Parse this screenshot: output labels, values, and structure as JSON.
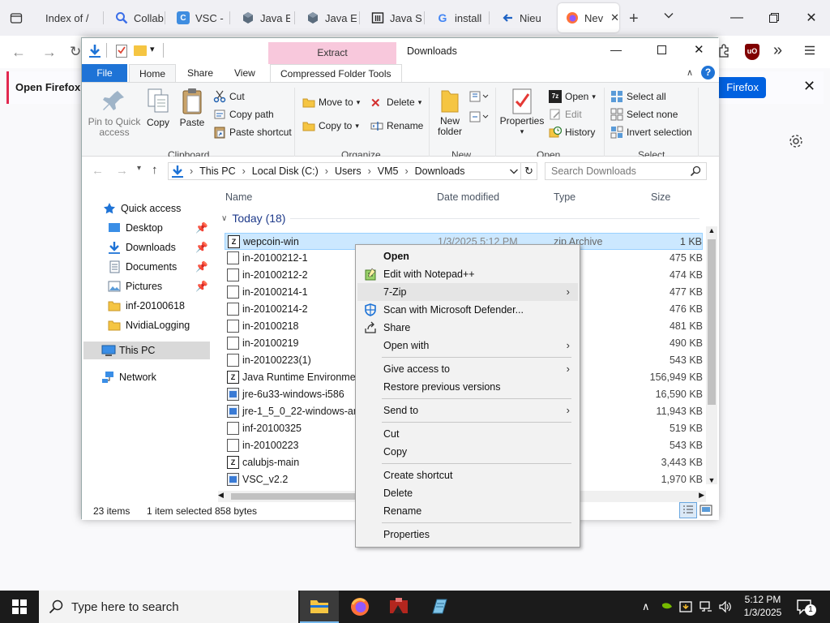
{
  "browser": {
    "tabs": [
      {
        "label": "Index of /"
      },
      {
        "label": "Collab"
      },
      {
        "label": "VSC -"
      },
      {
        "label": "Java E"
      },
      {
        "label": "Java E"
      },
      {
        "label": "Java S"
      },
      {
        "label": "install"
      },
      {
        "label": "Nieu"
      },
      {
        "label": "Nev"
      }
    ],
    "notification": {
      "text": "Open Firefox e",
      "button": "Firefox"
    }
  },
  "explorer": {
    "title": "Downloads",
    "context_tab": "Extract",
    "ribbon_tabs": [
      "File",
      "Home",
      "Share",
      "View",
      "Compressed Folder Tools"
    ],
    "clipboard": {
      "pin": "Pin to Quick access",
      "copy": "Copy",
      "paste": "Paste",
      "cut": "Cut",
      "copy_path": "Copy path",
      "paste_shortcut": "Paste shortcut",
      "group": "Clipboard"
    },
    "organize": {
      "move_to": "Move to",
      "copy_to": "Copy to",
      "delete": "Delete",
      "rename": "Rename",
      "group": "Organize"
    },
    "new": {
      "new_folder": "New folder",
      "group": "New"
    },
    "open": {
      "properties": "Properties",
      "open": "Open",
      "edit": "Edit",
      "history": "History",
      "group": "Open"
    },
    "select": {
      "select_all": "Select all",
      "select_none": "Select none",
      "invert": "Invert selection",
      "group": "Select"
    },
    "address": {
      "crumbs": [
        "This PC",
        "Local Disk (C:)",
        "Users",
        "VM5",
        "Downloads"
      ],
      "search_placeholder": "Search Downloads"
    },
    "columns": {
      "name": "Name",
      "date": "Date modified",
      "type": "Type",
      "size": "Size"
    },
    "group_header": "Today (18)",
    "nav": {
      "quick_access": "Quick access",
      "items": [
        "Desktop",
        "Downloads",
        "Documents",
        "Pictures",
        "inf-20100618",
        "NvidiaLogging"
      ],
      "this_pc": "This PC",
      "network": "Network"
    },
    "files": [
      {
        "name": "wepcoin-win",
        "date": "1/3/2025 5:12 PM",
        "type": "zip Archive",
        "size": "1 KB"
      },
      {
        "name": "in-20100212-1",
        "date": "",
        "type": "e",
        "size": "475 KB"
      },
      {
        "name": "in-20100212-2",
        "date": "",
        "type": "e",
        "size": "474 KB"
      },
      {
        "name": "in-20100214-1",
        "date": "",
        "type": "e",
        "size": "477 KB"
      },
      {
        "name": "in-20100214-2",
        "date": "",
        "type": "e",
        "size": "476 KB"
      },
      {
        "name": "in-20100218",
        "date": "",
        "type": "e",
        "size": "481 KB"
      },
      {
        "name": "in-20100219",
        "date": "",
        "type": "e",
        "size": "490 KB"
      },
      {
        "name": "in-20100223(1)",
        "date": "",
        "type": "e",
        "size": "543 KB"
      },
      {
        "name": "Java Runtime Environment",
        "date": "",
        "type": "rchive",
        "size": "156,949 KB"
      },
      {
        "name": "jre-6u33-windows-i586",
        "date": "",
        "type": "ation",
        "size": "16,590 KB"
      },
      {
        "name": "jre-1_5_0_22-windows-amd",
        "date": "",
        "type": "ation",
        "size": "11,943 KB"
      },
      {
        "name": "inf-20100325",
        "date": "",
        "type": "e",
        "size": "519 KB"
      },
      {
        "name": "in-20100223",
        "date": "",
        "type": "e",
        "size": "543 KB"
      },
      {
        "name": "calubjs-main",
        "date": "",
        "type": "rchive",
        "size": "3,443 KB"
      },
      {
        "name": "VSC_v2.2",
        "date": "",
        "type": "ation",
        "size": "1,970 KB"
      }
    ],
    "status": {
      "count": "23 items",
      "selected": "1 item selected",
      "bytes": "858 bytes"
    }
  },
  "context_menu": {
    "items": [
      "Open",
      "Edit with Notepad++",
      "7-Zip",
      "Scan with Microsoft Defender...",
      "Share",
      "Open with",
      "Give access to",
      "Restore previous versions",
      "Send to",
      "Cut",
      "Copy",
      "Create shortcut",
      "Delete",
      "Rename",
      "Properties"
    ]
  },
  "taskbar": {
    "search_placeholder": "Type here to search",
    "time": "5:12 PM",
    "date": "1/3/2025",
    "notifications": "1"
  },
  "colors": {
    "accent": "#0078d4",
    "selection": "#cce8ff",
    "firefox_button": "#0061e0",
    "ribbon_context": "#f8c8dc"
  }
}
